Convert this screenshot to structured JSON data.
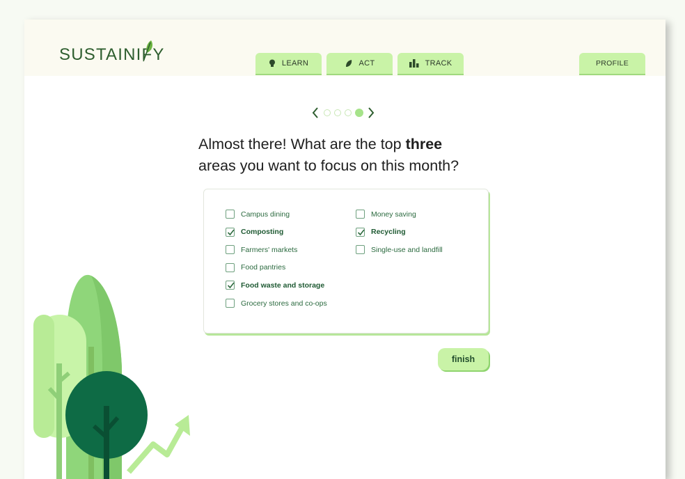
{
  "brand": {
    "name": "SUSTAINIFY"
  },
  "nav": {
    "tabs": [
      {
        "label": "LEARN",
        "icon": "lightbulb-icon"
      },
      {
        "label": "ACT",
        "icon": "leaf-icon"
      },
      {
        "label": "TRACK",
        "icon": "bar-chart-icon"
      }
    ],
    "profile_label": "PROFILE"
  },
  "pager": {
    "total": 4,
    "current": 4
  },
  "question": {
    "prefix": "Almost there! What are the top ",
    "emphasis": "three",
    "line2": "areas you want to focus on this month?"
  },
  "options": {
    "left": [
      {
        "label": "Campus dining",
        "checked": false
      },
      {
        "label": "Composting",
        "checked": true
      },
      {
        "label": "Farmers' markets",
        "checked": false
      },
      {
        "label": "Food pantries",
        "checked": false
      },
      {
        "label": "Food waste and storage",
        "checked": true
      },
      {
        "label": "Grocery stores and co-ops",
        "checked": false
      }
    ],
    "right": [
      {
        "label": "Money saving",
        "checked": false
      },
      {
        "label": "Recycling",
        "checked": true
      },
      {
        "label": "Single-use and landfill",
        "checked": false
      }
    ]
  },
  "finish_label": "finish",
  "colors": {
    "accent": "#c9f3a7",
    "brand_text": "#2e5e2f",
    "option_text": "#2b6a3f",
    "tree_dark": "#0e6b45",
    "tree_light": "#c8f4a8"
  }
}
